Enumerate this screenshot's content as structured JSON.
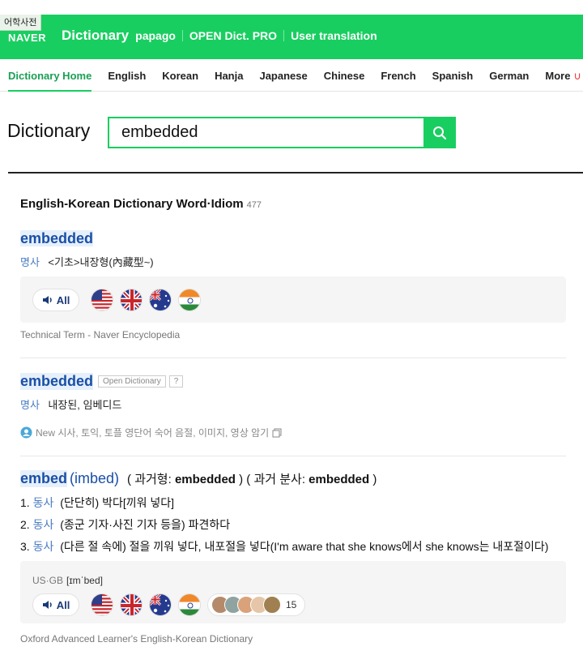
{
  "header": {
    "badge": "어학사전",
    "brand": "NAVER",
    "title": "Dictionary",
    "links": [
      "papago",
      "OPEN Dict. PRO",
      "User translation"
    ]
  },
  "tabs": [
    "Dictionary Home",
    "English",
    "Korean",
    "Hanja",
    "Japanese",
    "Chinese",
    "French",
    "Spanish",
    "German",
    "More"
  ],
  "search": {
    "title": "Dictionary",
    "query": "embedded"
  },
  "section": {
    "title": "English-Korean Dictionary Word·Idiom",
    "count": "477"
  },
  "entry1": {
    "word": "embedded",
    "pos": "명사",
    "meaning": "<기초>내장형(內藏型~)",
    "all_label": "All",
    "source": "Technical Term - Naver Encyclopedia"
  },
  "entry2": {
    "word": "embedded",
    "badge": "Open Dictionary",
    "badge_q": "?",
    "pos": "명사",
    "meaning": "내장된, 임베디드",
    "note": "New 시사, 토익, 토플 영단어 숙어 음절, 이미지, 영상 암기"
  },
  "entry3": {
    "word": "embed",
    "pron": "(imbed)",
    "forms_prefix": "( 과거형: ",
    "past": "embedded",
    "forms_mid": " ) ( 과거 분사: ",
    "pp": "embedded",
    "forms_suffix": " )",
    "senses": [
      {
        "num": "1.",
        "pos": "동사",
        "text": "(단단히) 박다[끼워 넣다]"
      },
      {
        "num": "2.",
        "pos": "동사",
        "text": "(종군 기자·사진 기자 등을) 파견하다"
      },
      {
        "num": "3.",
        "pos": "동사",
        "text": "(다른 절 속에) 절을 끼워 넣다, 내포절을 넣다(I'm aware that she knows에서 she knows는 내포절이다)"
      }
    ],
    "region": "US·GB",
    "ipa": "[ɪmˈbed]",
    "all_label": "All",
    "audio_count": "15",
    "source": "Oxford Advanced Learner's English-Korean Dictionary"
  },
  "colors": {
    "brand_green": "#19ce60",
    "link_blue": "#1a4fa6",
    "pos_blue": "#4a7cc2"
  }
}
